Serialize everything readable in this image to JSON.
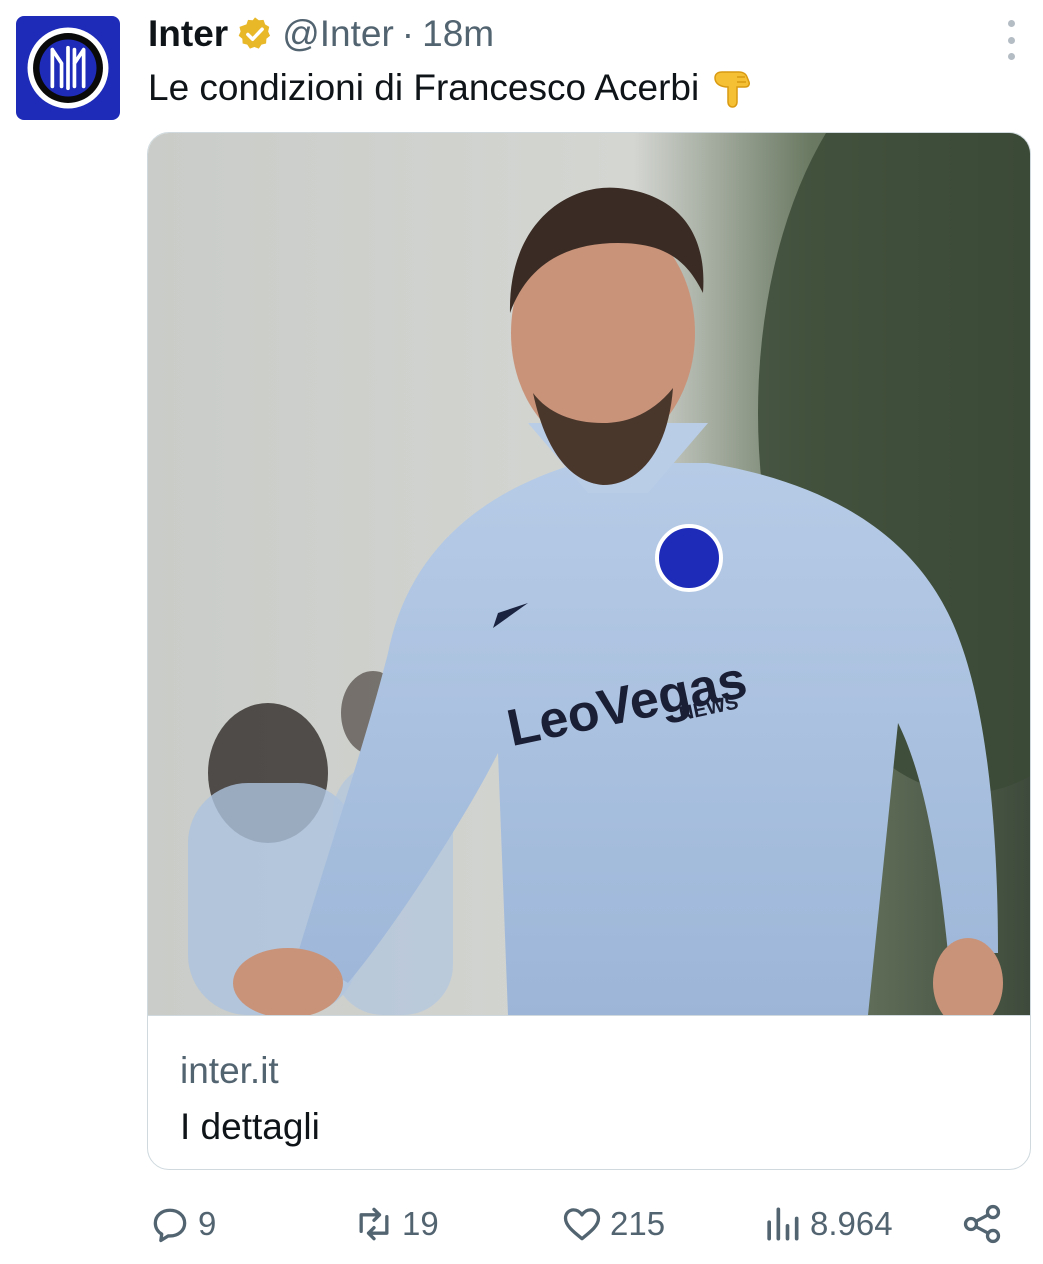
{
  "author": {
    "name": "Inter",
    "handle": "@Inter",
    "separator": "·",
    "time": "18m",
    "verified": true,
    "avatar_icon": "inter-logo",
    "brand_color": "#1e2bb8"
  },
  "tweet": {
    "text": "Le condizioni di Francesco Acerbi",
    "emoji": "backhand-index-pointing-down"
  },
  "card": {
    "image_description": "Player in light blue training top with LeoVegas sponsor",
    "domain": "inter.it",
    "title": "I dettagli"
  },
  "actions": {
    "replies": "9",
    "reposts": "19",
    "likes": "215",
    "views": "8.964"
  },
  "colors": {
    "text_primary": "#0f1419",
    "text_secondary": "#536471",
    "border": "#cfd9de",
    "verified_gold": "#e8b829"
  }
}
